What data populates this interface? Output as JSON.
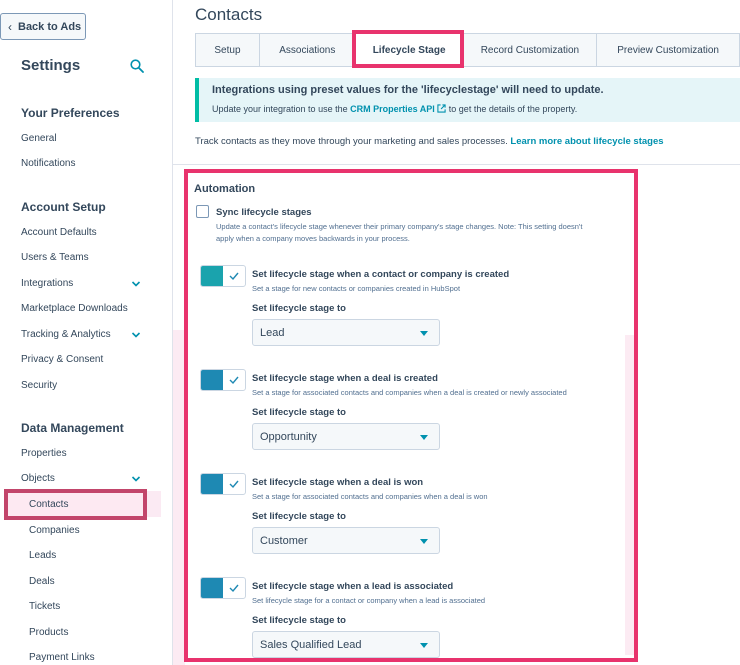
{
  "colors": {
    "accent": "#0091ae",
    "highlight": "#e8336d",
    "toggle_on": "#1e89b3"
  },
  "sidebar": {
    "back_label": "Back to Ads",
    "title": "Settings",
    "sections": [
      {
        "heading": "Your Preferences",
        "items": [
          "General",
          "Notifications"
        ]
      },
      {
        "heading": "Account Setup",
        "items": [
          "Account Defaults",
          "Users & Teams",
          "Integrations",
          "Marketplace Downloads",
          "Tracking & Analytics",
          "Privacy & Consent",
          "Security"
        ]
      },
      {
        "heading": "Data Management",
        "items": [
          "Properties",
          "Objects"
        ],
        "sub_items": [
          "Contacts",
          "Companies",
          "Leads",
          "Deals",
          "Tickets",
          "Products",
          "Payment Links"
        ]
      }
    ],
    "selected": "Contacts"
  },
  "main": {
    "title": "Contacts",
    "tabs": [
      "Setup",
      "Associations",
      "Lifecycle Stage",
      "Record Customization",
      "Preview Customization"
    ],
    "active_tab": "Lifecycle Stage",
    "alert": {
      "title": "Integrations using preset values for the 'lifecyclestage' will need to update.",
      "body_pre": "Update your integration to use the ",
      "link": "CRM Properties API",
      "body_post": " to get the details of the property."
    },
    "track_text": "Track contacts as they move through your marketing and sales processes. ",
    "track_link": "Learn more about lifecycle stages",
    "automation": {
      "title": "Automation",
      "sync_label": "Sync lifecycle stages",
      "sync_desc": "Update a contact's lifecycle stage whenever their primary company's stage changes. Note: This setting doesn't apply when a company moves backwards in your process.",
      "set_label": "Set lifecycle stage to",
      "rules": [
        {
          "title": "Set lifecycle stage when a contact or company is created",
          "desc": "Set a stage for new contacts or companies created in HubSpot",
          "value": "Lead",
          "on": true
        },
        {
          "title": "Set lifecycle stage when a deal is created",
          "desc": "Set a stage for associated contacts and companies when a deal is created or newly associated",
          "value": "Opportunity",
          "on": true
        },
        {
          "title": "Set lifecycle stage when a deal is won",
          "desc": "Set a stage for associated contacts and companies when a deal is won",
          "value": "Customer",
          "on": true
        },
        {
          "title": "Set lifecycle stage when a lead is associated",
          "desc": "Set lifecycle stage for a contact or company when a lead is associated",
          "value": "Sales Qualified Lead",
          "on": true
        }
      ]
    }
  }
}
